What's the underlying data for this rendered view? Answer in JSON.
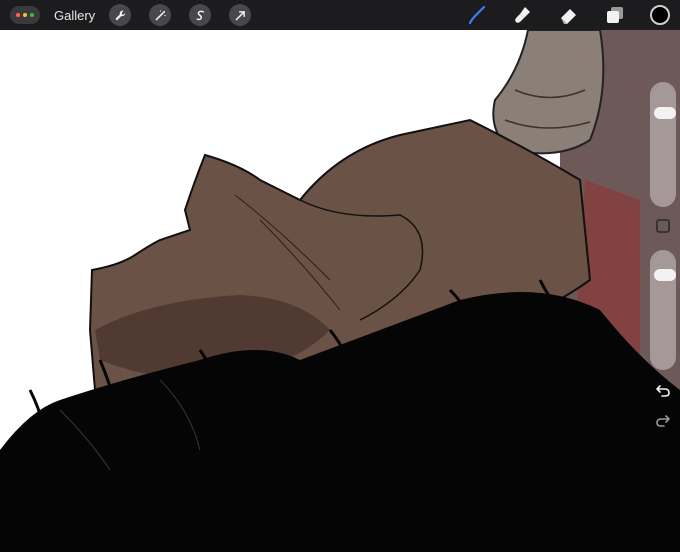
{
  "toolbar": {
    "gallery_label": "Gallery",
    "menu_dot_colors": [
      "#ff5f57",
      "#febc2e",
      "#28c840"
    ],
    "left_tools": [
      "wrench-icon",
      "magic-wand-icon",
      "selection-icon",
      "transform-arrow-icon"
    ],
    "right_tools": [
      "brush-icon",
      "smudge-icon",
      "eraser-icon",
      "layers-icon"
    ],
    "active_tool": "brush-icon",
    "accent_color": "#3d7cff",
    "current_color": "#000000"
  },
  "sidebar": {
    "brush_size_level": 0.2,
    "opacity_level": 0.15,
    "buttons": [
      "modify-square-icon",
      "undo-icon",
      "redo-icon"
    ]
  },
  "canvas": {
    "palette": {
      "background": "#ffffff",
      "skin": "#6b5246",
      "skin_shadow": "#4a342c",
      "hair": "#050505",
      "horn": "#8a8078",
      "red_accent": "#8a3b3b"
    }
  }
}
